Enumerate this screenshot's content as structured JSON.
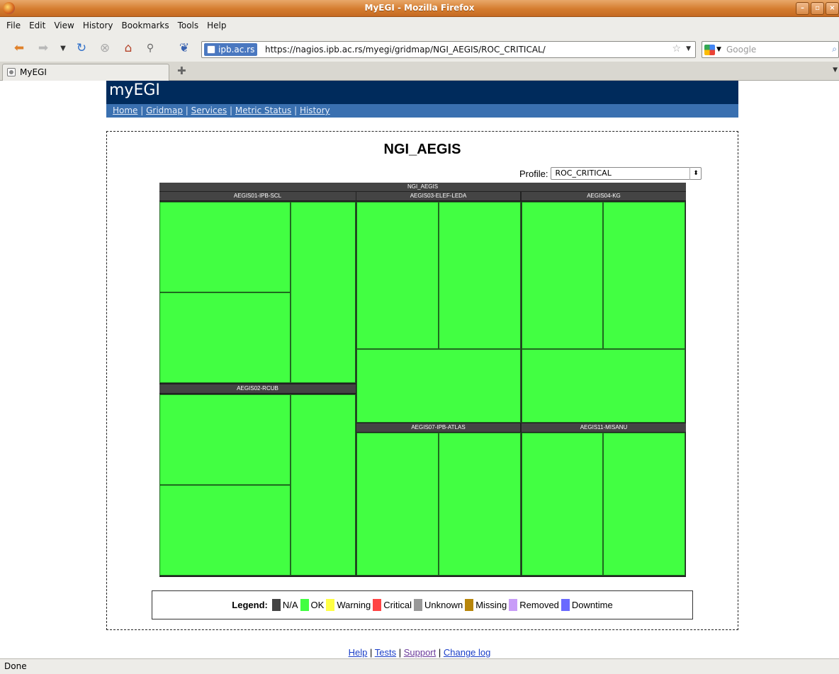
{
  "window": {
    "title": "MyEGI - Mozilla Firefox",
    "min": "–",
    "max": "▫",
    "close": "×"
  },
  "menu": [
    "File",
    "Edit",
    "View",
    "History",
    "Bookmarks",
    "Tools",
    "Help"
  ],
  "toolbar": {
    "site_badge": "ipb.ac.rs",
    "url": "https://nagios.ipb.ac.rs/myegi/gridmap/NGI_AEGIS/ROC_CRITICAL/",
    "search_placeholder": "Google"
  },
  "tab": {
    "label": "MyEGI"
  },
  "site": {
    "logo": "myEGI",
    "nav": [
      "Home",
      "Gridmap",
      "Services",
      "Metric Status",
      "History"
    ]
  },
  "page": {
    "title": "NGI_AEGIS",
    "profile_label": "Profile:",
    "profile_value": "ROC_CRITICAL"
  },
  "gridmap": {
    "root_label": "NGI_AEGIS",
    "sites": [
      "AEGIS01-IPB-SCL",
      "AEGIS03-ELEF-LEDA",
      "AEGIS04-KG",
      "AEGIS02-RCUB",
      "AEGIS07-IPB-ATLAS",
      "AEGIS11-MISANU"
    ],
    "ok_color": "#42ff42"
  },
  "legend": {
    "label": "Legend:",
    "items": [
      {
        "label": "N/A",
        "color": "#444444"
      },
      {
        "label": "OK",
        "color": "#42ff42"
      },
      {
        "label": "Warning",
        "color": "#ffff44"
      },
      {
        "label": "Critical",
        "color": "#ff4444"
      },
      {
        "label": "Unknown",
        "color": "#999999"
      },
      {
        "label": "Missing",
        "color": "#b8860b"
      },
      {
        "label": "Removed",
        "color": "#c89cf8"
      },
      {
        "label": "Downtime",
        "color": "#6a6aff"
      }
    ]
  },
  "footer": [
    "Help",
    "Tests",
    "Support",
    "Change log"
  ],
  "status": "Done"
}
